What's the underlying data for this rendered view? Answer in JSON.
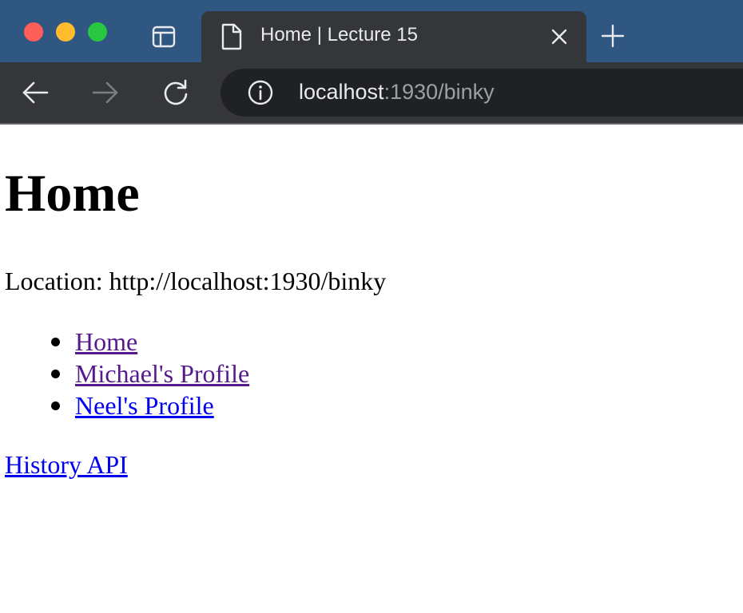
{
  "browser": {
    "tab_title": "Home | Lecture 15",
    "url_host": "localhost",
    "url_rest": ":1930/binky",
    "icons": {
      "window_controls": [
        "close-dot",
        "minimize-dot",
        "zoom-dot"
      ],
      "sidebar": "sidebar-icon",
      "tab_page": "page-icon",
      "tab_close": "close-icon",
      "new_tab": "plus-icon",
      "back": "arrow-left-icon",
      "forward": "arrow-right-icon",
      "reload": "reload-icon",
      "site_info": "info-icon"
    },
    "colors": {
      "tabstrip": "#2f5781",
      "toolbar": "#35363a",
      "omnibox": "#202124",
      "close_dot": "#fe5f57",
      "minimize_dot": "#febc2e",
      "zoom_dot": "#28c840"
    }
  },
  "page": {
    "title": "Home",
    "location_text": "Location: http://localhost:1930/binky",
    "nav_links": [
      {
        "label": "Home",
        "state": "visited"
      },
      {
        "label": "Michael's Profile",
        "state": "visited"
      },
      {
        "label": "Neel's Profile",
        "state": "unvisited"
      }
    ],
    "history_link": "History API",
    "colors": {
      "visited_link": "#551a8b",
      "unvisited_link": "#0000ee"
    }
  }
}
